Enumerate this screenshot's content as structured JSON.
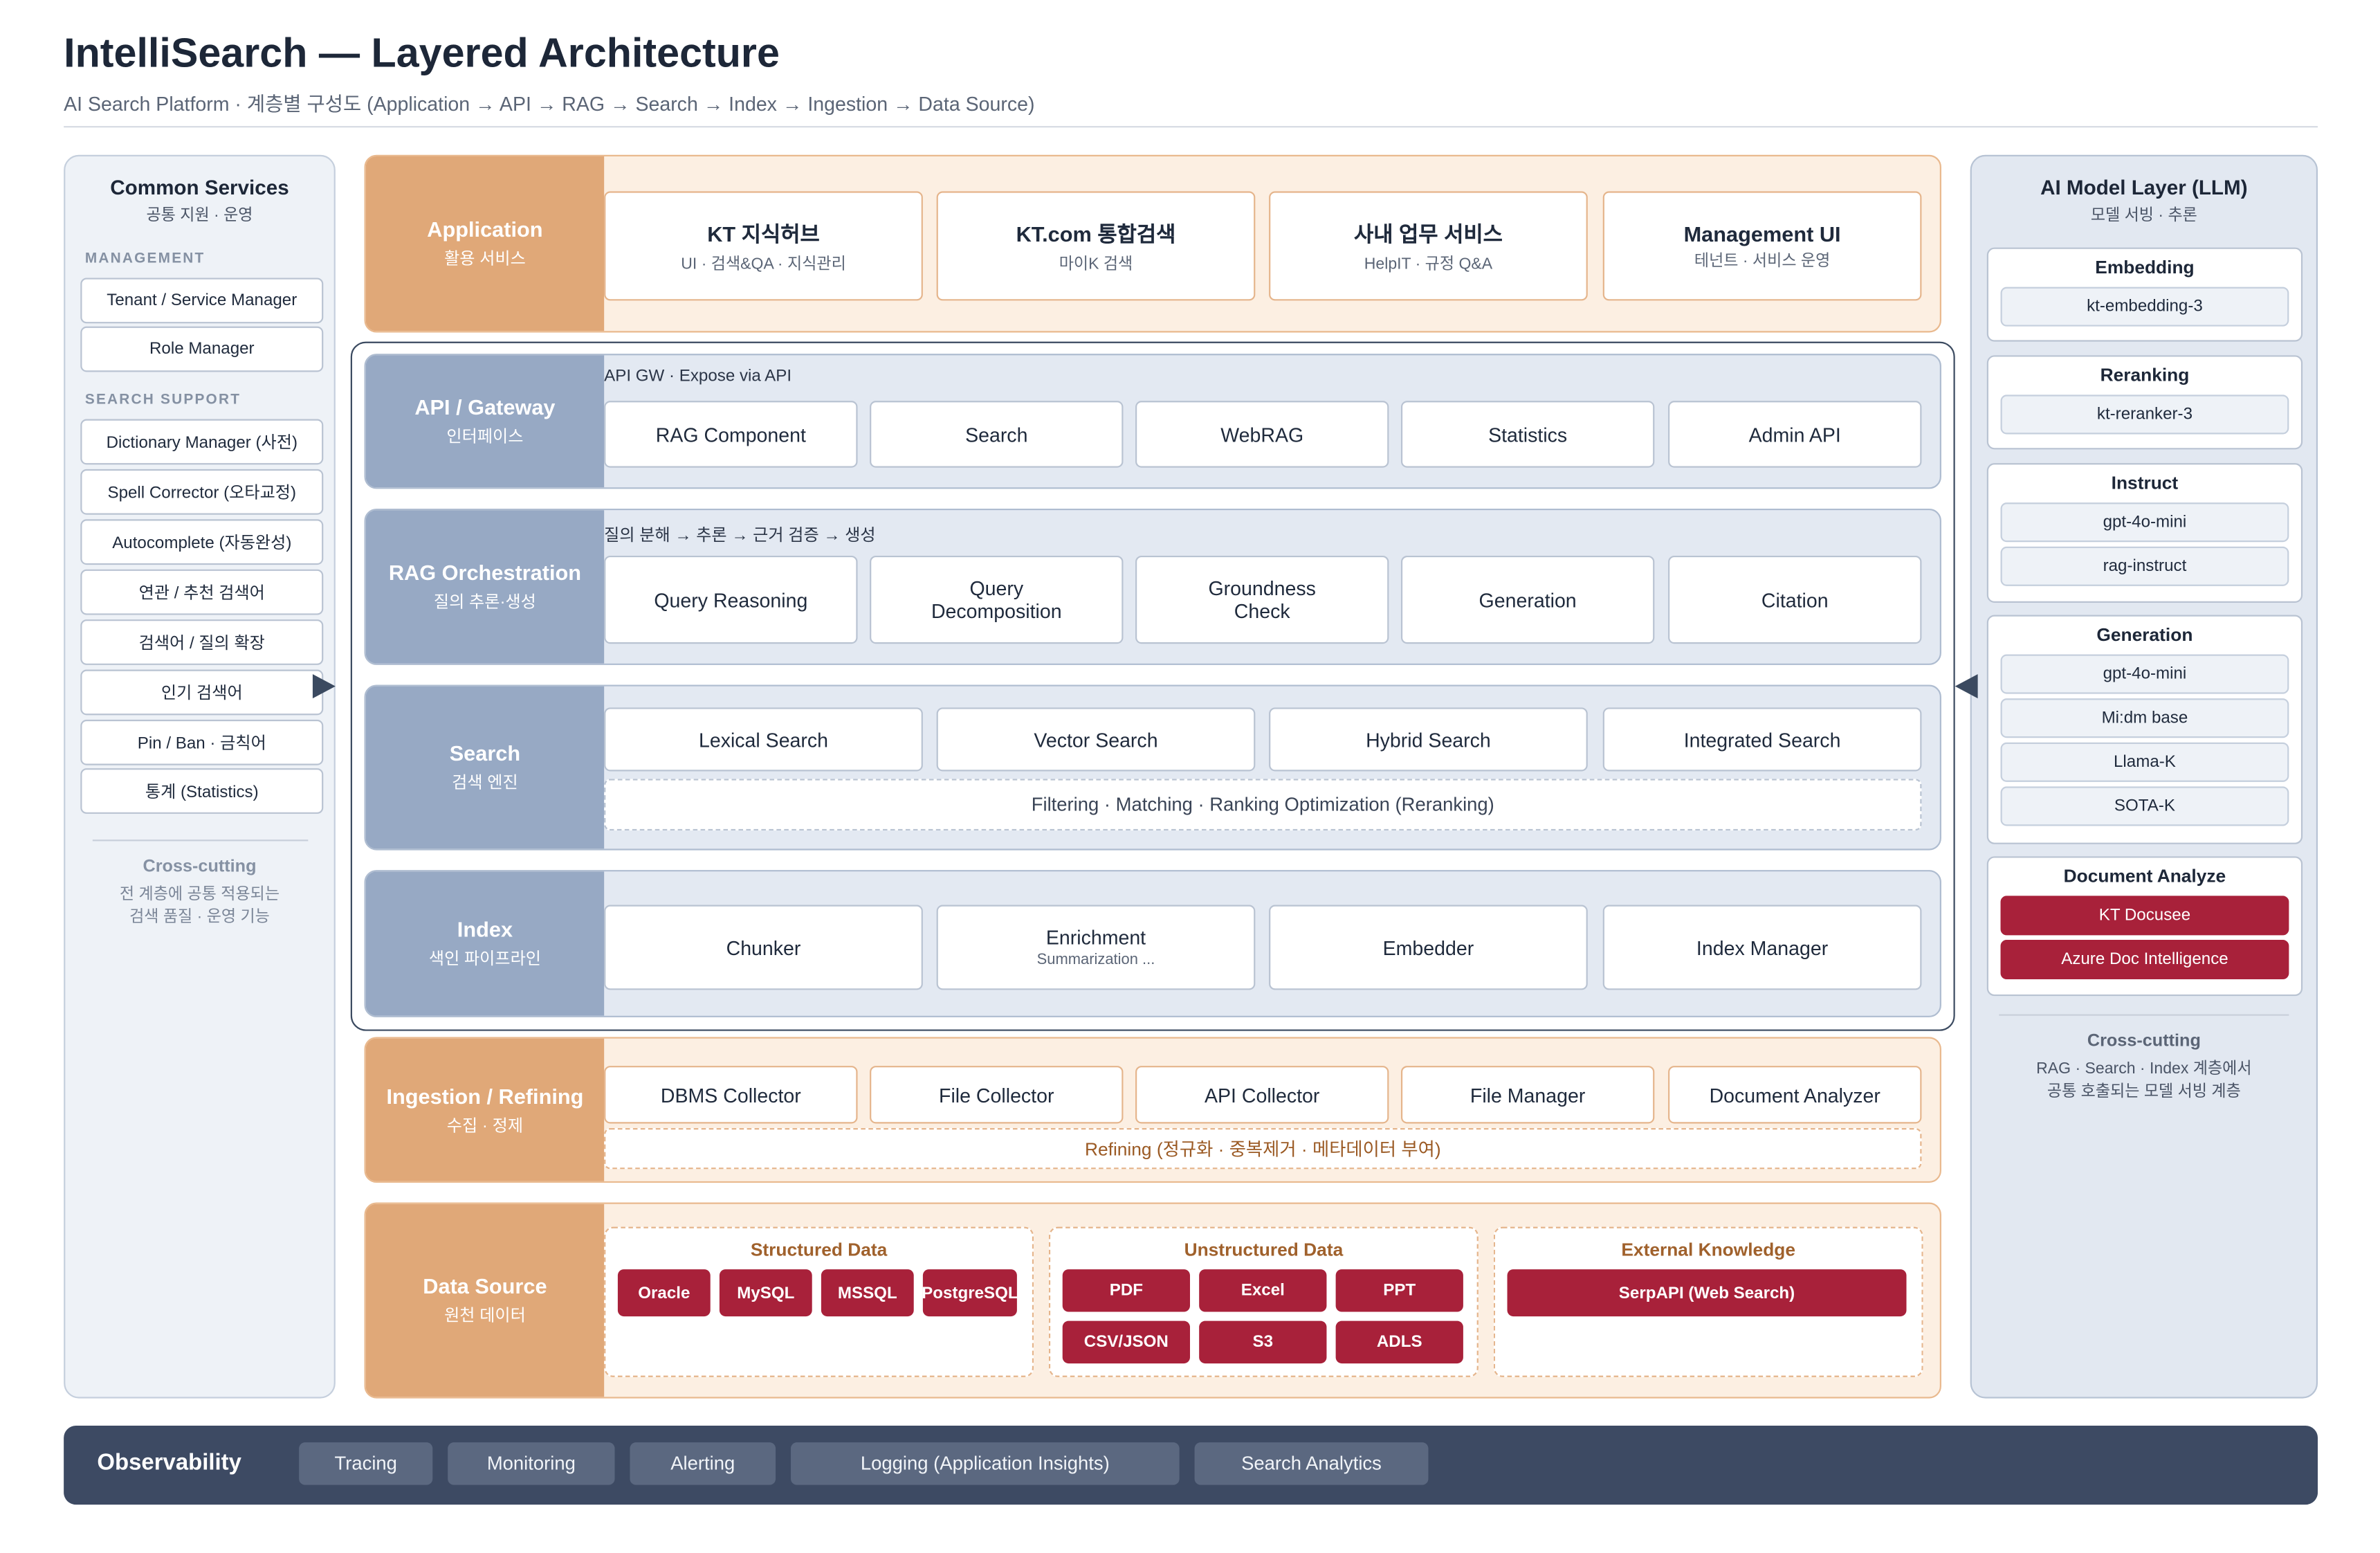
{
  "header": {
    "title": "IntelliSearch — Layered Architecture",
    "subtitle": "AI Search Platform · 계층별 구성도 (Application → API → RAG → Search → Index → Ingestion → Data Source)"
  },
  "common_services": {
    "title": "Common Services",
    "subtitle": "공통 지원 · 운영",
    "management_label": "MANAGEMENT",
    "management": [
      "Tenant / Service Manager",
      "Role Manager"
    ],
    "search_support_label": "SEARCH SUPPORT",
    "search_support": [
      "Dictionary Manager (사전)",
      "Spell Corrector (오타교정)",
      "Autocomplete (자동완성)",
      "연관 / 추천 검색어",
      "검색어 / 질의 확장",
      "인기 검색어",
      "Pin / Ban · 금칙어",
      "통계 (Statistics)"
    ],
    "cross_title": "Cross-cutting",
    "cross_line1": "전 계층에 공통 적용되는",
    "cross_line2": "검색 품질 · 운영 기능"
  },
  "layers": {
    "application": {
      "name": "Application",
      "sub": "활용 서비스",
      "items": [
        {
          "title": "KT 지식허브",
          "sub": "UI · 검색&QA · 지식관리"
        },
        {
          "title": "KT.com 통합검색",
          "sub": "마이K 검색"
        },
        {
          "title": "사내 업무 서비스",
          "sub": "HelpIT · 규정 Q&A"
        },
        {
          "title": "Management UI",
          "sub": "테넌트 · 서비스 운영"
        }
      ]
    },
    "api": {
      "name": "API / Gateway",
      "sub": "인터페이스",
      "caption": "API GW · Expose via API",
      "items": [
        "RAG Component",
        "Search",
        "WebRAG",
        "Statistics",
        "Admin API"
      ]
    },
    "rag": {
      "name": "RAG Orchestration",
      "sub": "질의 추론·생성",
      "caption": "질의 분해 → 추론 → 근거 검증 → 생성",
      "items": [
        {
          "l1": "Query Reasoning",
          "l2": ""
        },
        {
          "l1": "Query",
          "l2": "Decomposition"
        },
        {
          "l1": "Groundness",
          "l2": "Check"
        },
        {
          "l1": "Generation",
          "l2": ""
        },
        {
          "l1": "Citation",
          "l2": ""
        }
      ]
    },
    "search": {
      "name": "Search",
      "sub": "검색 엔진",
      "items": [
        "Lexical Search",
        "Vector Search",
        "Hybrid Search",
        "Integrated Search"
      ],
      "bar": "Filtering · Matching · Ranking Optimization (Reranking)"
    },
    "index": {
      "name": "Index",
      "sub": "색인 파이프라인",
      "items": [
        {
          "title": "Chunker",
          "sub": ""
        },
        {
          "title": "Enrichment",
          "sub": "Summarization ..."
        },
        {
          "title": "Embedder",
          "sub": ""
        },
        {
          "title": "Index Manager",
          "sub": ""
        }
      ]
    },
    "ingestion": {
      "name": "Ingestion / Refining",
      "sub": "수집 · 정제",
      "items": [
        "DBMS Collector",
        "File Collector",
        "API Collector",
        "File Manager",
        "Document Analyzer"
      ],
      "bar": "Refining (정규화 · 중복제거 · 메타데이터 부여)"
    },
    "datasource": {
      "name": "Data Source",
      "sub": "원천 데이터",
      "structured": {
        "title": "Structured Data",
        "items": [
          "Oracle",
          "MySQL",
          "MSSQL",
          "PostgreSQL"
        ]
      },
      "unstructured": {
        "title": "Unstructured Data",
        "items": [
          "PDF",
          "Excel",
          "PPT",
          "CSV/JSON",
          "S3",
          "ADLS"
        ]
      },
      "external": {
        "title": "External Knowledge",
        "items": [
          "SerpAPI (Web Search)"
        ]
      }
    }
  },
  "model_layer": {
    "title": "AI Model Layer (LLM)",
    "subtitle": "모델 서빙 · 추론",
    "groups": [
      {
        "title": "Embedding",
        "items": [
          "kt-embedding-3"
        ]
      },
      {
        "title": "Reranking",
        "items": [
          "kt-reranker-3"
        ]
      },
      {
        "title": "Instruct",
        "items": [
          "gpt-4o-mini",
          "rag-instruct"
        ]
      },
      {
        "title": "Generation",
        "items": [
          "gpt-4o-mini",
          "Mi:dm base",
          "Llama-K",
          "SOTA-K"
        ]
      },
      {
        "title": "Document Analyze",
        "items": [
          "KT Docusee",
          "Azure Doc Intelligence"
        ]
      }
    ],
    "cross_title": "Cross-cutting",
    "cross_line1": "RAG · Search · Index 계층에서",
    "cross_line2": "공통 호출되는 모델 서빙 계층"
  },
  "observability": {
    "title": "Observability",
    "items": [
      "Tracing",
      "Monitoring",
      "Alerting",
      "Logging (Application Insights)",
      "Search Analytics"
    ]
  },
  "colors": {
    "accent_orange": "#e0a878",
    "accent_blue": "#97a9c4",
    "data_chip": "#a8213a",
    "observability_bg": "#3d4a63"
  }
}
